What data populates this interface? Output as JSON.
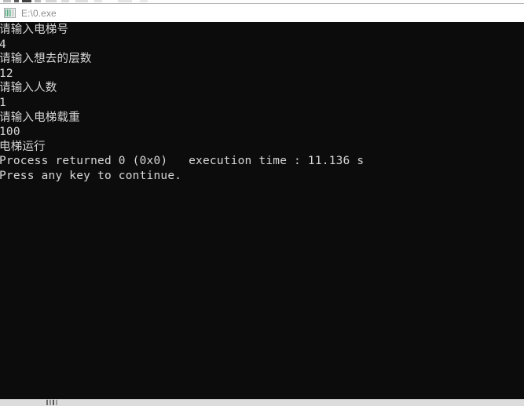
{
  "window": {
    "title": "E:\\0.exe",
    "icon": "console-app-icon",
    "background_color": "#0c0c0c",
    "text_color": "#d7d7d7",
    "titlebar_color": "#ffffff"
  },
  "console": {
    "lines": [
      "请输入电梯号",
      "4",
      "请输入想去的层数",
      "12",
      "请输入人数",
      "1",
      "请输入电梯载重",
      "100",
      "电梯运行",
      "Process returned 0 (0x0)   execution time : 11.136 s",
      "Press any key to continue."
    ],
    "full_text": "请输入电梯号\n4\n请输入想去的层数\n12\n请输入人数\n1\n请输入电梯载重\n100\n电梯运行\nProcess returned 0 (0x0)   execution time : 11.136 s\nPress any key to continue.",
    "exit_code": "0 (0x0)",
    "execution_time": "11.136 s",
    "prompt": "Press any key to continue."
  }
}
